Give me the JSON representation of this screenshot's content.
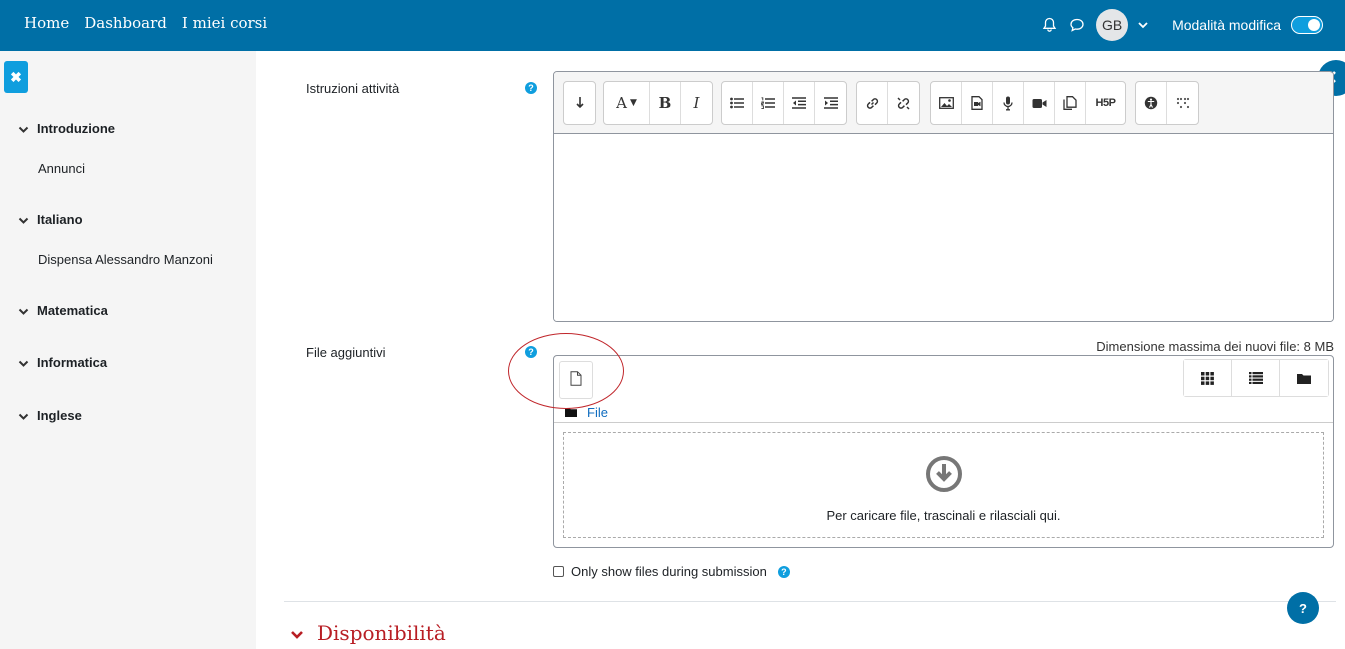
{
  "navbar": {
    "links": [
      "Home",
      "Dashboard",
      "I miei corsi"
    ],
    "avatar_initials": "GB",
    "edit_mode_label": "Modalità modifica",
    "edit_mode_on": true,
    "color": "#006fa6"
  },
  "sidebar": {
    "sections": [
      {
        "title": "Introduzione",
        "items": [
          "Annunci"
        ]
      },
      {
        "title": "Italiano",
        "items": [
          "Dispensa Alessandro Manzoni"
        ]
      },
      {
        "title": "Matematica",
        "items": []
      },
      {
        "title": "Informatica",
        "items": []
      },
      {
        "title": "Inglese",
        "items": []
      }
    ]
  },
  "form": {
    "instructions_label": "Istruzioni attività",
    "toolbar_icons": [
      "collapse-icon",
      "font-style-icon",
      "bold-icon",
      "italic-icon",
      "bullet-list-icon",
      "numbered-list-icon",
      "outdent-icon",
      "indent-icon",
      "link-icon",
      "unlink-icon",
      "image-icon",
      "media-icon",
      "record-audio-icon",
      "record-video-icon",
      "manage-files-icon",
      "h5p-icon",
      "accessibility-checker-icon",
      "screenreader-helper-icon"
    ],
    "toolbar_text": {
      "bold": "B",
      "italic": "I",
      "h5p": "H5P"
    },
    "files_label": "File aggiuntivi",
    "max_size": "Dimensione massima dei nuovi file: 8 MB",
    "folder_path": "File",
    "dropzone_text": "Per caricare file, trascinali e rilasciali qui.",
    "only_show_files_label": "Only show files during submission",
    "only_show_files_checked": false
  },
  "availability_heading": "Disponibilità",
  "help_button": "?"
}
